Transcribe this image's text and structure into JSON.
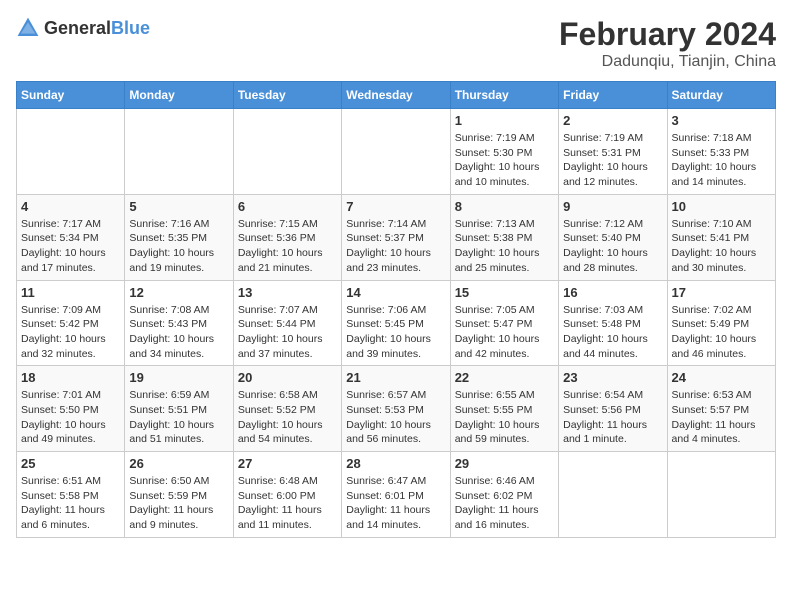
{
  "header": {
    "logo_general": "General",
    "logo_blue": "Blue",
    "month_year": "February 2024",
    "location": "Dadunqiu, Tianjin, China"
  },
  "weekdays": [
    "Sunday",
    "Monday",
    "Tuesday",
    "Wednesday",
    "Thursday",
    "Friday",
    "Saturday"
  ],
  "weeks": [
    [
      {
        "day": "",
        "info": ""
      },
      {
        "day": "",
        "info": ""
      },
      {
        "day": "",
        "info": ""
      },
      {
        "day": "",
        "info": ""
      },
      {
        "day": "1",
        "sunrise": "7:19 AM",
        "sunset": "5:30 PM",
        "daylight": "10 hours and 10 minutes."
      },
      {
        "day": "2",
        "sunrise": "7:19 AM",
        "sunset": "5:31 PM",
        "daylight": "10 hours and 12 minutes."
      },
      {
        "day": "3",
        "sunrise": "7:18 AM",
        "sunset": "5:33 PM",
        "daylight": "10 hours and 14 minutes."
      }
    ],
    [
      {
        "day": "4",
        "sunrise": "7:17 AM",
        "sunset": "5:34 PM",
        "daylight": "10 hours and 17 minutes."
      },
      {
        "day": "5",
        "sunrise": "7:16 AM",
        "sunset": "5:35 PM",
        "daylight": "10 hours and 19 minutes."
      },
      {
        "day": "6",
        "sunrise": "7:15 AM",
        "sunset": "5:36 PM",
        "daylight": "10 hours and 21 minutes."
      },
      {
        "day": "7",
        "sunrise": "7:14 AM",
        "sunset": "5:37 PM",
        "daylight": "10 hours and 23 minutes."
      },
      {
        "day": "8",
        "sunrise": "7:13 AM",
        "sunset": "5:38 PM",
        "daylight": "10 hours and 25 minutes."
      },
      {
        "day": "9",
        "sunrise": "7:12 AM",
        "sunset": "5:40 PM",
        "daylight": "10 hours and 28 minutes."
      },
      {
        "day": "10",
        "sunrise": "7:10 AM",
        "sunset": "5:41 PM",
        "daylight": "10 hours and 30 minutes."
      }
    ],
    [
      {
        "day": "11",
        "sunrise": "7:09 AM",
        "sunset": "5:42 PM",
        "daylight": "10 hours and 32 minutes."
      },
      {
        "day": "12",
        "sunrise": "7:08 AM",
        "sunset": "5:43 PM",
        "daylight": "10 hours and 34 minutes."
      },
      {
        "day": "13",
        "sunrise": "7:07 AM",
        "sunset": "5:44 PM",
        "daylight": "10 hours and 37 minutes."
      },
      {
        "day": "14",
        "sunrise": "7:06 AM",
        "sunset": "5:45 PM",
        "daylight": "10 hours and 39 minutes."
      },
      {
        "day": "15",
        "sunrise": "7:05 AM",
        "sunset": "5:47 PM",
        "daylight": "10 hours and 42 minutes."
      },
      {
        "day": "16",
        "sunrise": "7:03 AM",
        "sunset": "5:48 PM",
        "daylight": "10 hours and 44 minutes."
      },
      {
        "day": "17",
        "sunrise": "7:02 AM",
        "sunset": "5:49 PM",
        "daylight": "10 hours and 46 minutes."
      }
    ],
    [
      {
        "day": "18",
        "sunrise": "7:01 AM",
        "sunset": "5:50 PM",
        "daylight": "10 hours and 49 minutes."
      },
      {
        "day": "19",
        "sunrise": "6:59 AM",
        "sunset": "5:51 PM",
        "daylight": "10 hours and 51 minutes."
      },
      {
        "day": "20",
        "sunrise": "6:58 AM",
        "sunset": "5:52 PM",
        "daylight": "10 hours and 54 minutes."
      },
      {
        "day": "21",
        "sunrise": "6:57 AM",
        "sunset": "5:53 PM",
        "daylight": "10 hours and 56 minutes."
      },
      {
        "day": "22",
        "sunrise": "6:55 AM",
        "sunset": "5:55 PM",
        "daylight": "10 hours and 59 minutes."
      },
      {
        "day": "23",
        "sunrise": "6:54 AM",
        "sunset": "5:56 PM",
        "daylight": "11 hours and 1 minute."
      },
      {
        "day": "24",
        "sunrise": "6:53 AM",
        "sunset": "5:57 PM",
        "daylight": "11 hours and 4 minutes."
      }
    ],
    [
      {
        "day": "25",
        "sunrise": "6:51 AM",
        "sunset": "5:58 PM",
        "daylight": "11 hours and 6 minutes."
      },
      {
        "day": "26",
        "sunrise": "6:50 AM",
        "sunset": "5:59 PM",
        "daylight": "11 hours and 9 minutes."
      },
      {
        "day": "27",
        "sunrise": "6:48 AM",
        "sunset": "6:00 PM",
        "daylight": "11 hours and 11 minutes."
      },
      {
        "day": "28",
        "sunrise": "6:47 AM",
        "sunset": "6:01 PM",
        "daylight": "11 hours and 14 minutes."
      },
      {
        "day": "29",
        "sunrise": "6:46 AM",
        "sunset": "6:02 PM",
        "daylight": "11 hours and 16 minutes."
      },
      {
        "day": "",
        "info": ""
      },
      {
        "day": "",
        "info": ""
      }
    ]
  ]
}
